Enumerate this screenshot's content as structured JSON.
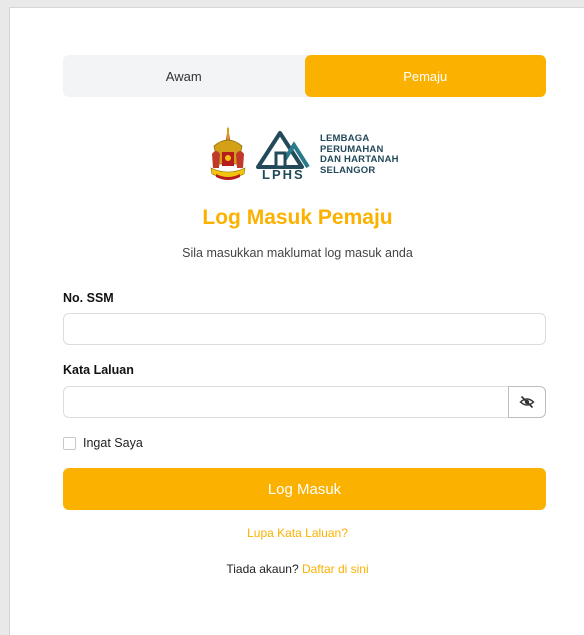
{
  "tabs": [
    {
      "label": "Awam",
      "active": false
    },
    {
      "label": "Pemaju",
      "active": true
    }
  ],
  "logo": {
    "lphs_mark": "LPHS",
    "org_lines": [
      "LEMBAGA",
      "PERUMAHAN",
      "DAN HARTANAH",
      "SELANGOR"
    ],
    "crest_label": "SELANGOR"
  },
  "title": "Log Masuk Pemaju",
  "subtitle": "Sila masukkan maklumat log masuk anda",
  "form": {
    "ssm_label": "No. SSM",
    "ssm_value": "",
    "password_label": "Kata Laluan",
    "password_value": "",
    "toggle_icon": "eye-slash-icon",
    "remember_label": "Ingat Saya",
    "remember_checked": false,
    "submit_label": "Log Masuk"
  },
  "links": {
    "forgot": "Lupa Kata Laluan?",
    "no_account_text": "Tiada akaun?",
    "signup": "Daftar di sini"
  },
  "colors": {
    "accent": "#fbb100",
    "logo_text": "#234a5a"
  }
}
